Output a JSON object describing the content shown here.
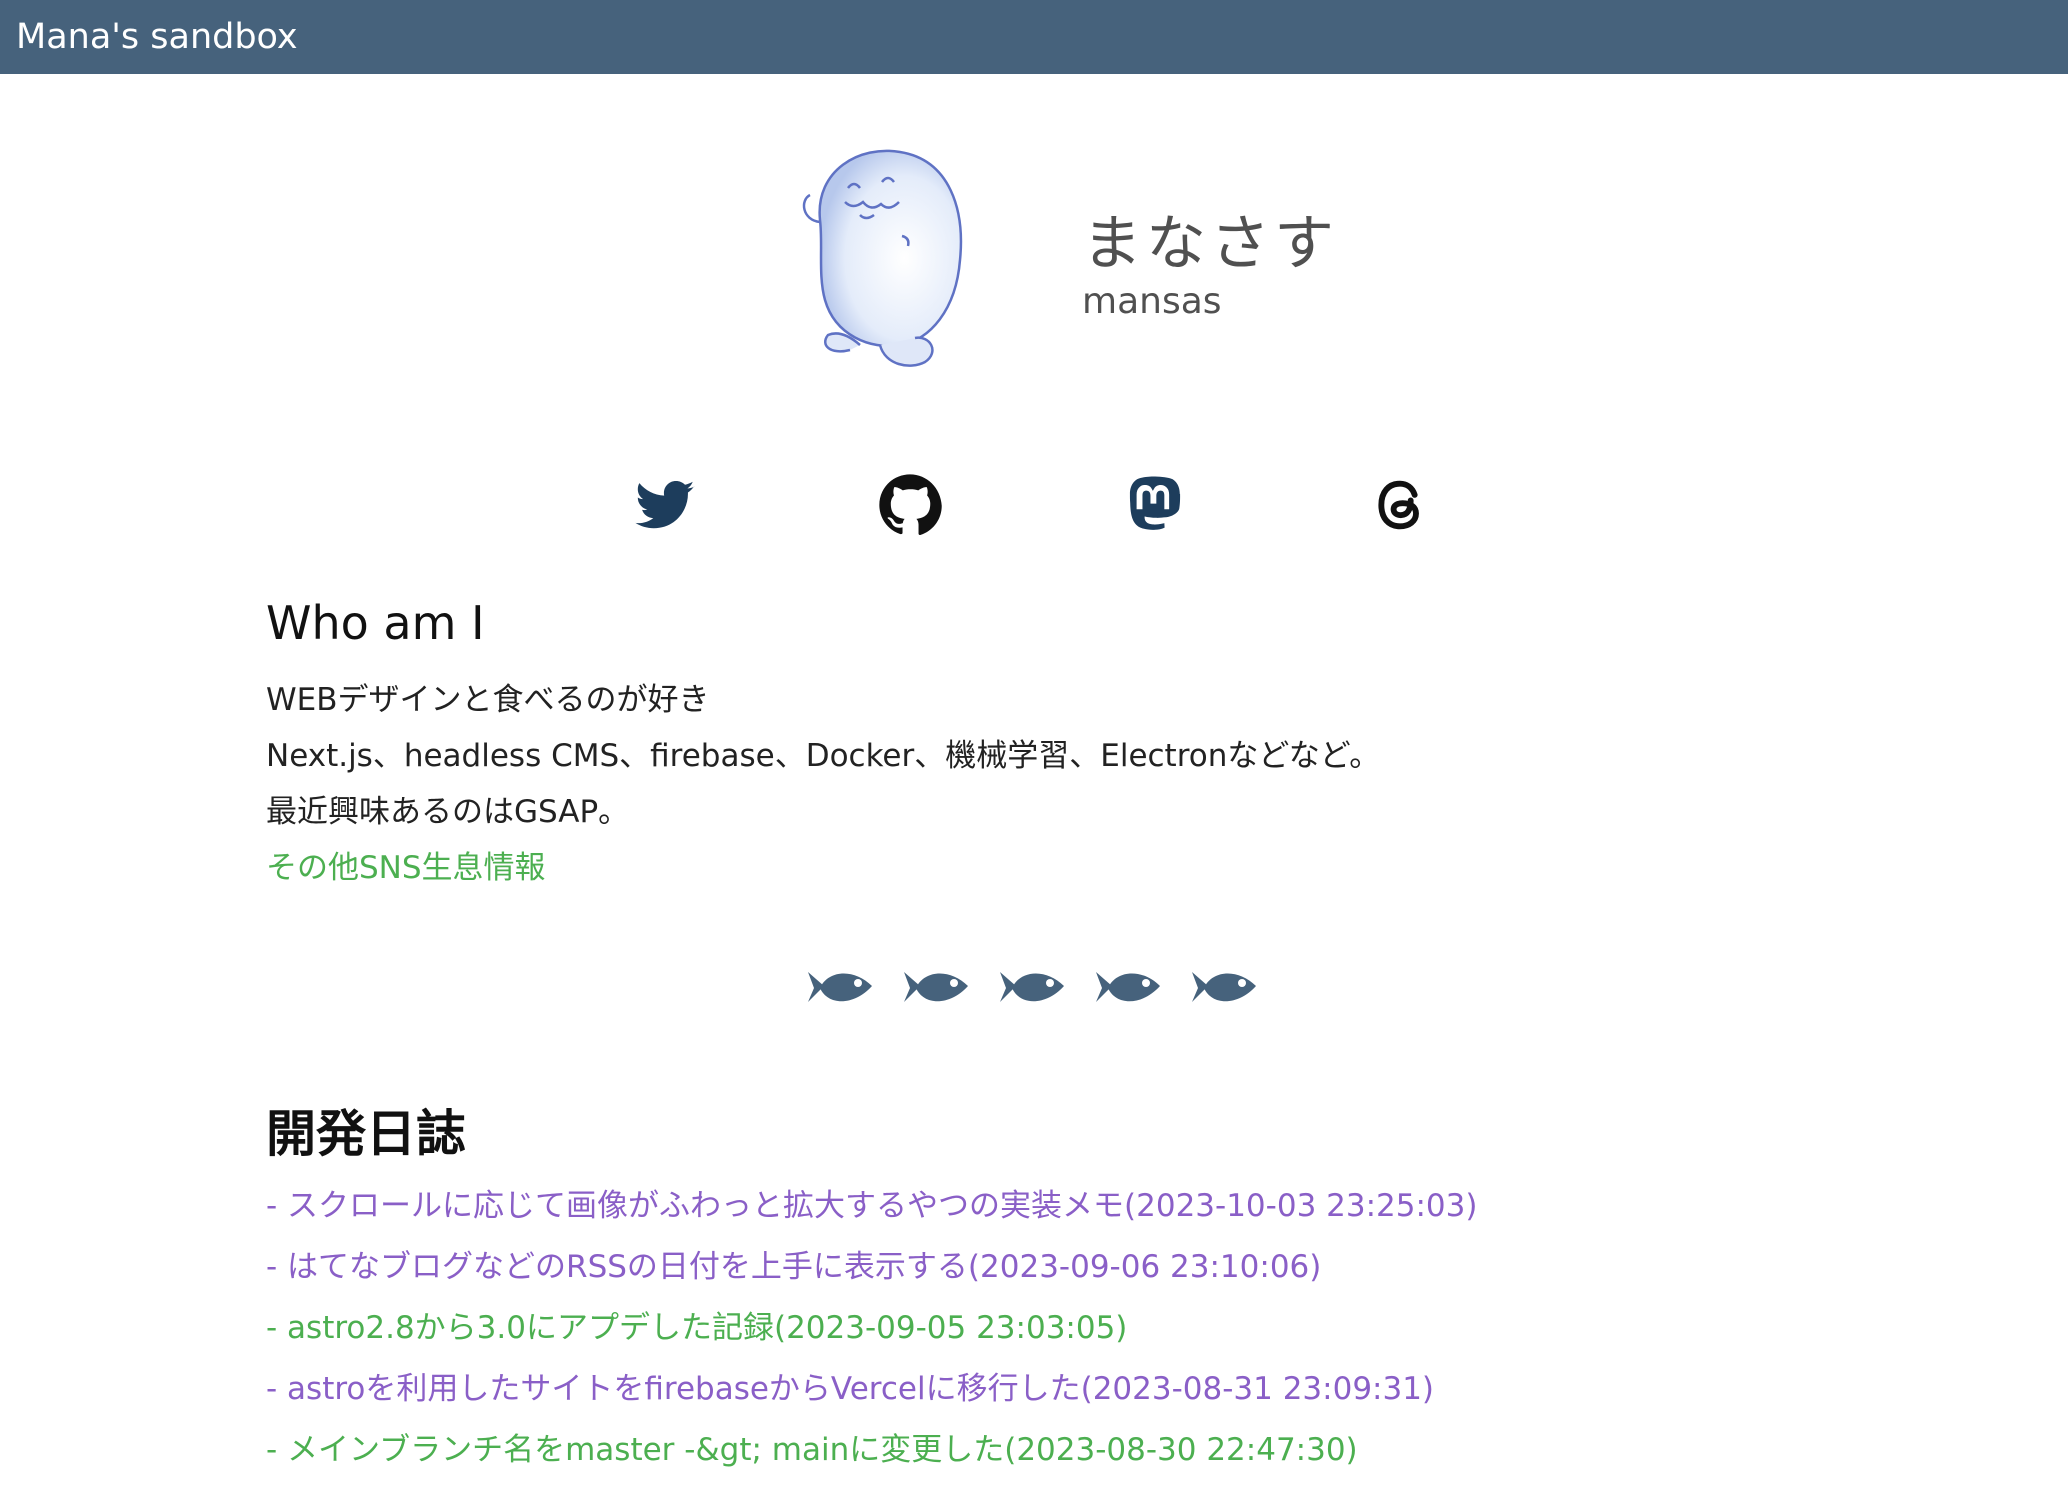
{
  "header": {
    "title": "Mana's sandbox"
  },
  "profile": {
    "avatar_icon": "seal-avatar-icon",
    "name_jp": "まなさす",
    "name_en": "mansas"
  },
  "sns": [
    {
      "icon": "twitter-icon",
      "color": "#1d3d5c"
    },
    {
      "icon": "github-icon",
      "color": "#111111"
    },
    {
      "icon": "mastodon-icon",
      "color": "#1d3d5c"
    },
    {
      "icon": "threads-icon",
      "color": "#111111"
    }
  ],
  "who": {
    "heading": "Who am I",
    "line1": "WEBデザインと食べるのが好き",
    "line2": "Next.js、headless CMS、firebase、Docker、機械学習、Electronなどなど。",
    "line3": "最近興味あるのはGSAP。",
    "link": "その他SNS生息情報"
  },
  "divider": {
    "icon": "fish-icon",
    "count": 5,
    "color": "#46627c"
  },
  "diary": {
    "heading": "開発日誌",
    "items": [
      {
        "text": "- スクロールに応じて画像がふわっと拡大するやつの実装メモ(2023-10-03 23:25:03)",
        "state": "visited"
      },
      {
        "text": "- はてなブログなどのRSSの日付を上手に表示する(2023-09-06 23:10:06)",
        "state": "visited"
      },
      {
        "text": "- astro2.8から3.0にアプデした記録(2023-09-05 23:03:05)",
        "state": "unvisited"
      },
      {
        "text": "- astroを利用したサイトをfirebaseからVercelに移行した(2023-08-31 23:09:31)",
        "state": "visited"
      },
      {
        "text": "- メインブランチ名をmaster -&gt; mainに変更した(2023-08-30 22:47:30)",
        "state": "unvisited"
      }
    ]
  },
  "colors": {
    "header_bg": "#46627c",
    "link_visited": "#8a5fc7",
    "link_unvisited": "#4caf50"
  }
}
